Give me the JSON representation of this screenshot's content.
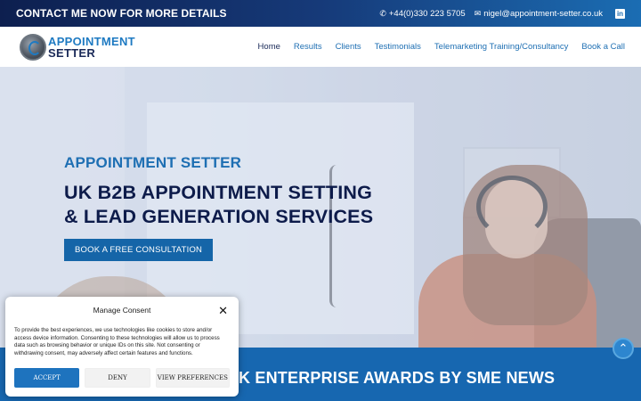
{
  "topbar": {
    "cta": "CONTACT ME NOW FOR MORE DETAILS",
    "phone_icon": "phone-icon",
    "phone": "+44(0)330 223 5705",
    "email_icon": "envelope-icon",
    "email": "nigel@appointment-setter.co.uk",
    "social_icon": "linkedin-icon",
    "social_glyph": "in"
  },
  "header": {
    "logo_line1": "APPOINTMENT",
    "logo_line2": "SETTER",
    "nav": [
      {
        "label": "Home"
      },
      {
        "label": "Results"
      },
      {
        "label": "Clients"
      },
      {
        "label": "Testimonials"
      },
      {
        "label": "Telemarketing Training/Consultancy"
      },
      {
        "label": "Book a Call"
      }
    ]
  },
  "hero": {
    "subtitle": "APPOINTMENT SETTER",
    "title_line1": "UK B2B APPOINTMENT SETTING",
    "title_line2": "& LEAD GENERATION SERVICES",
    "button": "BOOK A FREE CONSULTATION"
  },
  "band": {
    "title": "K ENTERPRISE AWARDS BY SME NEWS"
  },
  "scroll_top": {
    "icon": "chevron-up-icon",
    "glyph": "⌃"
  },
  "consent": {
    "title": "Manage Consent",
    "close_glyph": "✕",
    "text": "To provide the best experiences, we use technologies like cookies to store and/or access device information. Consenting to these technologies will allow us to process data such as browsing behavior or unique IDs on this site. Not consenting or withdrawing consent, may adversely affect certain features and functions.",
    "accept": "ACCEPT",
    "deny": "DENY",
    "preferences": "VIEW PREFERENCES"
  },
  "colors": {
    "brand_dark": "#0d1b4a",
    "brand_blue": "#1e6fb3",
    "button_blue": "#1565a8"
  }
}
